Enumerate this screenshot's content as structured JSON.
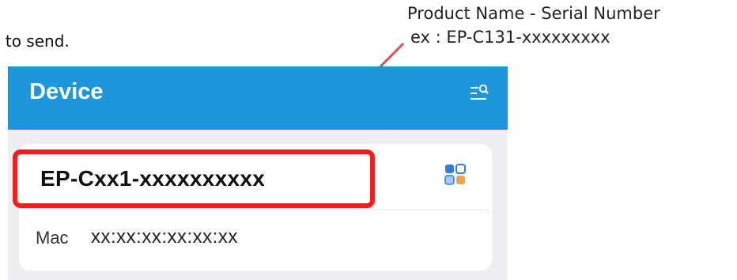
{
  "instruction": {
    "text": "nt to send."
  },
  "annotation": {
    "line1": "Product Name - Serial Number",
    "line2": "ex : EP-C131-xxxxxxxxx"
  },
  "header": {
    "title": "Device",
    "filter_icon": "list-search-icon"
  },
  "device_card": {
    "name": "EP-Cxx1-xxxxxxxxxx",
    "mac_label": "Mac",
    "mac_value": "xx:xx:xx:xx:xx:xx",
    "grid_icon": "four-squares-icon"
  },
  "colors": {
    "header_bg": "#1e96dc",
    "highlight": "#ff1a1a",
    "arrow": "#d9534f",
    "page_bg": "#efeff3",
    "card_bg": "#ffffff",
    "icon_blue": "#2f7fd6",
    "icon_orange": "#f2a24a",
    "icon_light_blue": "#a9c9ef"
  }
}
